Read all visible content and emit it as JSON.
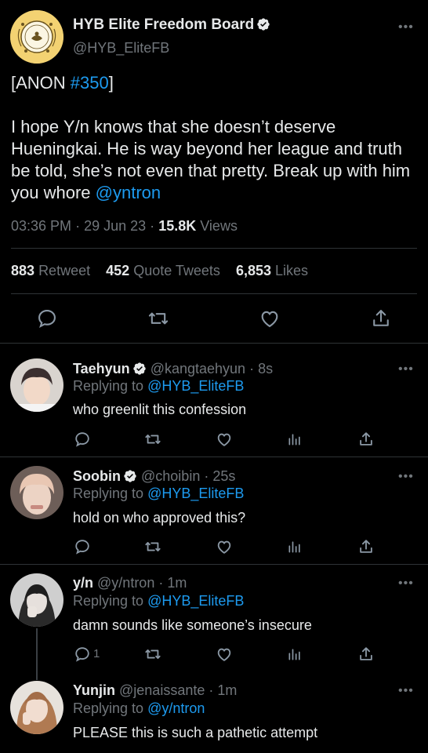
{
  "main_tweet": {
    "display_name": "HYB Elite Freedom Board",
    "handle": "@HYB_EliteFB",
    "more": "•••",
    "text_prefix": "[ANON ",
    "hashtag": "#350",
    "text_suffix": "]",
    "body": "I hope Y/n knows that she doesn’t deserve Hueningkai. He is way beyond her league and truth be told, she’s not even that pretty. Break up with him you whore",
    "mention": "@yntron",
    "time": "03:36 PM",
    "date": "29 Jun 23",
    "views_count": "15.8K",
    "views_label": "Views",
    "retweets_count": "883",
    "retweets_label": "Retweet",
    "quotes_count": "452",
    "quotes_label": "Quote Tweets",
    "likes_count": "6,853",
    "likes_label": "Likes"
  },
  "replies": [
    {
      "name": "Taehyun",
      "verified": true,
      "handle": "@kangtaehyun",
      "time": "8s",
      "replying_label": "Replying to",
      "replying_to": "@HYB_EliteFB",
      "text": "who greenlit this confession",
      "reply_count": ""
    },
    {
      "name": "Soobin",
      "verified": true,
      "handle": "@choibin",
      "time": "25s",
      "replying_label": "Replying to",
      "replying_to": "@HYB_EliteFB",
      "text": "hold on who approved this?",
      "reply_count": ""
    },
    {
      "name": "y/n",
      "verified": false,
      "handle": "@y/ntron",
      "time": "1m",
      "replying_label": "Replying to",
      "replying_to": "@HYB_EliteFB",
      "text": "damn sounds like someone’s insecure",
      "reply_count": "1"
    },
    {
      "name": "Yunjin",
      "verified": false,
      "handle": "@jenaissante",
      "time": "1m",
      "replying_label": "Replying to",
      "replying_to": "@y/ntron",
      "text": "PLEASE this is such a pathetic attempt",
      "reply_count": ""
    }
  ],
  "dot": "·",
  "colors": {
    "background": "#000000",
    "link": "#1d9bf0",
    "muted": "#71767b",
    "text": "#e7e9ea",
    "divider": "#2f3336"
  }
}
